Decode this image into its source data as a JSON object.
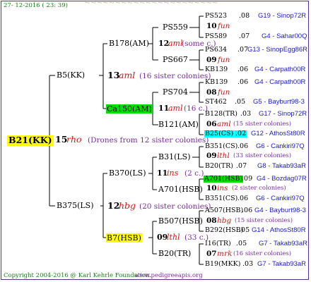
{
  "header": {
    "date": "27- 12-2016 ( 23: 39)"
  },
  "footer": {
    "copyright": "Copyright 2004-2016 @ Karl Kehrle Foundation.",
    "url": "www.pedigreeapis.org"
  },
  "root": {
    "name": "B21(KK)",
    "num": "15",
    "mark": "rho",
    "note": "(Drones from 12 sister colonies)"
  },
  "g1": [
    {
      "name": "B5(KK)",
      "num": "13",
      "mark": "aml",
      "note": "(16 sister colonies)"
    },
    {
      "name": "B375(LS)",
      "num": "12",
      "mark": "hbg",
      "note": "(20 sister colonies)"
    }
  ],
  "g2": [
    {
      "name": "B178(AM)",
      "num": "12",
      "mark": "aml",
      "note": "(some c.)"
    },
    {
      "name": "Ca150(AM)",
      "num": "11",
      "mark": "aml",
      "note": "(16 c.)"
    },
    {
      "name": "B370(LS)",
      "num": "11",
      "mark": "ins",
      "note": "(2 c.)"
    },
    {
      "name": "B7(HSB)",
      "num": "09",
      "mark": "lthl",
      "note": "(33 c.)"
    }
  ],
  "g3": [
    {
      "name": "PS559",
      "num": "",
      "mark": "",
      "note": ""
    },
    {
      "name": "PS667",
      "num": "",
      "mark": "",
      "note": ""
    },
    {
      "name": "PS704",
      "num": "",
      "mark": "",
      "note": ""
    },
    {
      "name": "B121(AM)",
      "num": "",
      "mark": "",
      "note": ""
    },
    {
      "name": "B31(LS)",
      "num": "",
      "mark": "",
      "note": ""
    },
    {
      "name": "A701(HSB)",
      "num": "",
      "mark": "",
      "note": ""
    },
    {
      "name": "B507(HSB)",
      "num": "",
      "mark": "",
      "note": ""
    },
    {
      "name": "B20(TR)",
      "num": "",
      "mark": "",
      "note": ""
    }
  ],
  "g4": [
    {
      "a": "PS523",
      "v": ".08",
      "b": "G19 - Sinop72R"
    },
    {
      "num": "10",
      "mark": "fun"
    },
    {
      "a": "PS589",
      "v": ".07",
      "b": "G4 - Sahar00Q"
    },
    {
      "a": "PS634",
      "v": ".07",
      "b": "G13 - SinopEgg86R"
    },
    {
      "num": "09",
      "mark": "fun"
    },
    {
      "a": "KB139",
      "v": ".06",
      "b": "G4 - Carpath00R"
    },
    {
      "a": "KB139",
      "v": ".06",
      "b": "G4 - Carpath00R"
    },
    {
      "num": "08",
      "mark": "fun"
    },
    {
      "a": "ST462",
      "v": ".05",
      "b": "G5 - Bayburt98-3"
    },
    {
      "a": "B128(TR)",
      "v": ".03",
      "b": "G17 - Sinop72R"
    },
    {
      "num": "06",
      "mark": "aml",
      "note": "(15 sister colonies)"
    },
    {
      "a": "B25(CS)",
      "v": ".02",
      "b": "G12 - AthosSt80R"
    },
    {
      "a": "B351(CS)",
      "v": ".06",
      "b": "G6 - Cankiri97Q"
    },
    {
      "num": "09",
      "mark": "lthl",
      "note": "(33 sister colonies)"
    },
    {
      "a": "B20(TR)",
      "v": ".07",
      "b": "G8 - Takab93aR"
    },
    {
      "a": "A701(HSB)",
      "v": ".09",
      "b": "G4 - Bozdag07R"
    },
    {
      "num": "10",
      "mark": "ins",
      "note": "(2 sister colonies)"
    },
    {
      "a": "B351(CS)",
      "v": ".06",
      "b": "G6 - Cankiri97Q"
    },
    {
      "a": "A507(HSB)",
      "v": ".06",
      "b": "G4 - Bayburt98-3"
    },
    {
      "num": "08",
      "mark": "hbg",
      "note": "(15 sister colonies)"
    },
    {
      "a": "B292(HSB)",
      "v": ".05",
      "b": "G14 - AthosSt80R"
    },
    {
      "a": "I16(TR)",
      "v": ".05",
      "b": "G7 - Takab93aR"
    },
    {
      "num": "07",
      "mark": "mrk",
      "note": "(16 sister colonies)"
    },
    {
      "a": "B19(MKK)",
      "v": ".03",
      "b": "G7 - Takab93aR"
    }
  ]
}
